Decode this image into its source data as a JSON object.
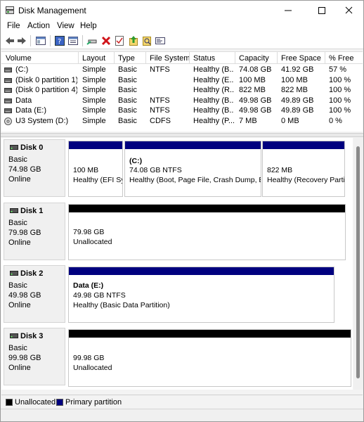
{
  "window": {
    "title": "Disk Management"
  },
  "menu": [
    "File",
    "Action",
    "View",
    "Help"
  ],
  "toolbar": [
    "back-icon",
    "forward-icon",
    "console-tree-icon",
    "help-icon",
    "properties-view-icon",
    "connect-drive-icon",
    "delete-icon",
    "check-icon",
    "export-icon",
    "rescan-icon",
    "console-icon"
  ],
  "volume_list": {
    "columns": [
      "Volume",
      "Layout",
      "Type",
      "File System",
      "Status",
      "Capacity",
      "Free Space",
      "% Free"
    ],
    "rows": [
      [
        "(C:)",
        "Simple",
        "Basic",
        "NTFS",
        "Healthy (B...",
        "74.08 GB",
        "41.92 GB",
        "57 %"
      ],
      [
        "(Disk 0 partition 1)",
        "Simple",
        "Basic",
        "",
        "Healthy (E...",
        "100 MB",
        "100 MB",
        "100 %"
      ],
      [
        "(Disk 0 partition 4)",
        "Simple",
        "Basic",
        "",
        "Healthy (R...",
        "822 MB",
        "822 MB",
        "100 %"
      ],
      [
        "Data",
        "Simple",
        "Basic",
        "NTFS",
        "Healthy (B...",
        "49.98 GB",
        "49.89 GB",
        "100 %"
      ],
      [
        "Data (E:)",
        "Simple",
        "Basic",
        "NTFS",
        "Healthy (B...",
        "49.98 GB",
        "49.89 GB",
        "100 %"
      ],
      [
        "U3 System (D:)",
        "Simple",
        "Basic",
        "CDFS",
        "Healthy (P...",
        "7 MB",
        "0 MB",
        "0 %"
      ]
    ]
  },
  "disks": [
    {
      "name": "Disk 0",
      "type": "Basic",
      "size": "74.98 GB",
      "status": "Online",
      "partitions": [
        {
          "title": "",
          "line1": "100 MB",
          "line2": "Healthy (EFI System Partition)",
          "kind": "primary"
        },
        {
          "title": "(C:)",
          "line1": "74.08 GB NTFS",
          "line2": "Healthy (Boot, Page File, Crash Dump, Basic Data Partition)",
          "kind": "primary"
        },
        {
          "title": "",
          "line1": "822 MB",
          "line2": "Healthy (Recovery Partition)",
          "kind": "primary"
        }
      ]
    },
    {
      "name": "Disk 1",
      "type": "Basic",
      "size": "79.98 GB",
      "status": "Online",
      "partitions": [
        {
          "title": "",
          "line1": "79.98 GB",
          "line2": "Unallocated",
          "kind": "unallocated"
        }
      ]
    },
    {
      "name": "Disk 2",
      "type": "Basic",
      "size": "49.98 GB",
      "status": "Online",
      "partitions": [
        {
          "title": "Data  (E:)",
          "line1": "49.98 GB NTFS",
          "line2": "Healthy (Basic Data Partition)",
          "kind": "primary"
        }
      ]
    },
    {
      "name": "Disk 3",
      "type": "Basic",
      "size": "99.98 GB",
      "status": "Online",
      "partitions": [
        {
          "title": "",
          "line1": "99.98 GB",
          "line2": "Unallocated",
          "kind": "unallocated"
        }
      ]
    }
  ],
  "legend": [
    {
      "label": "Unallocated",
      "color": "#000000"
    },
    {
      "label": "Primary partition",
      "color": "#00007f"
    }
  ]
}
